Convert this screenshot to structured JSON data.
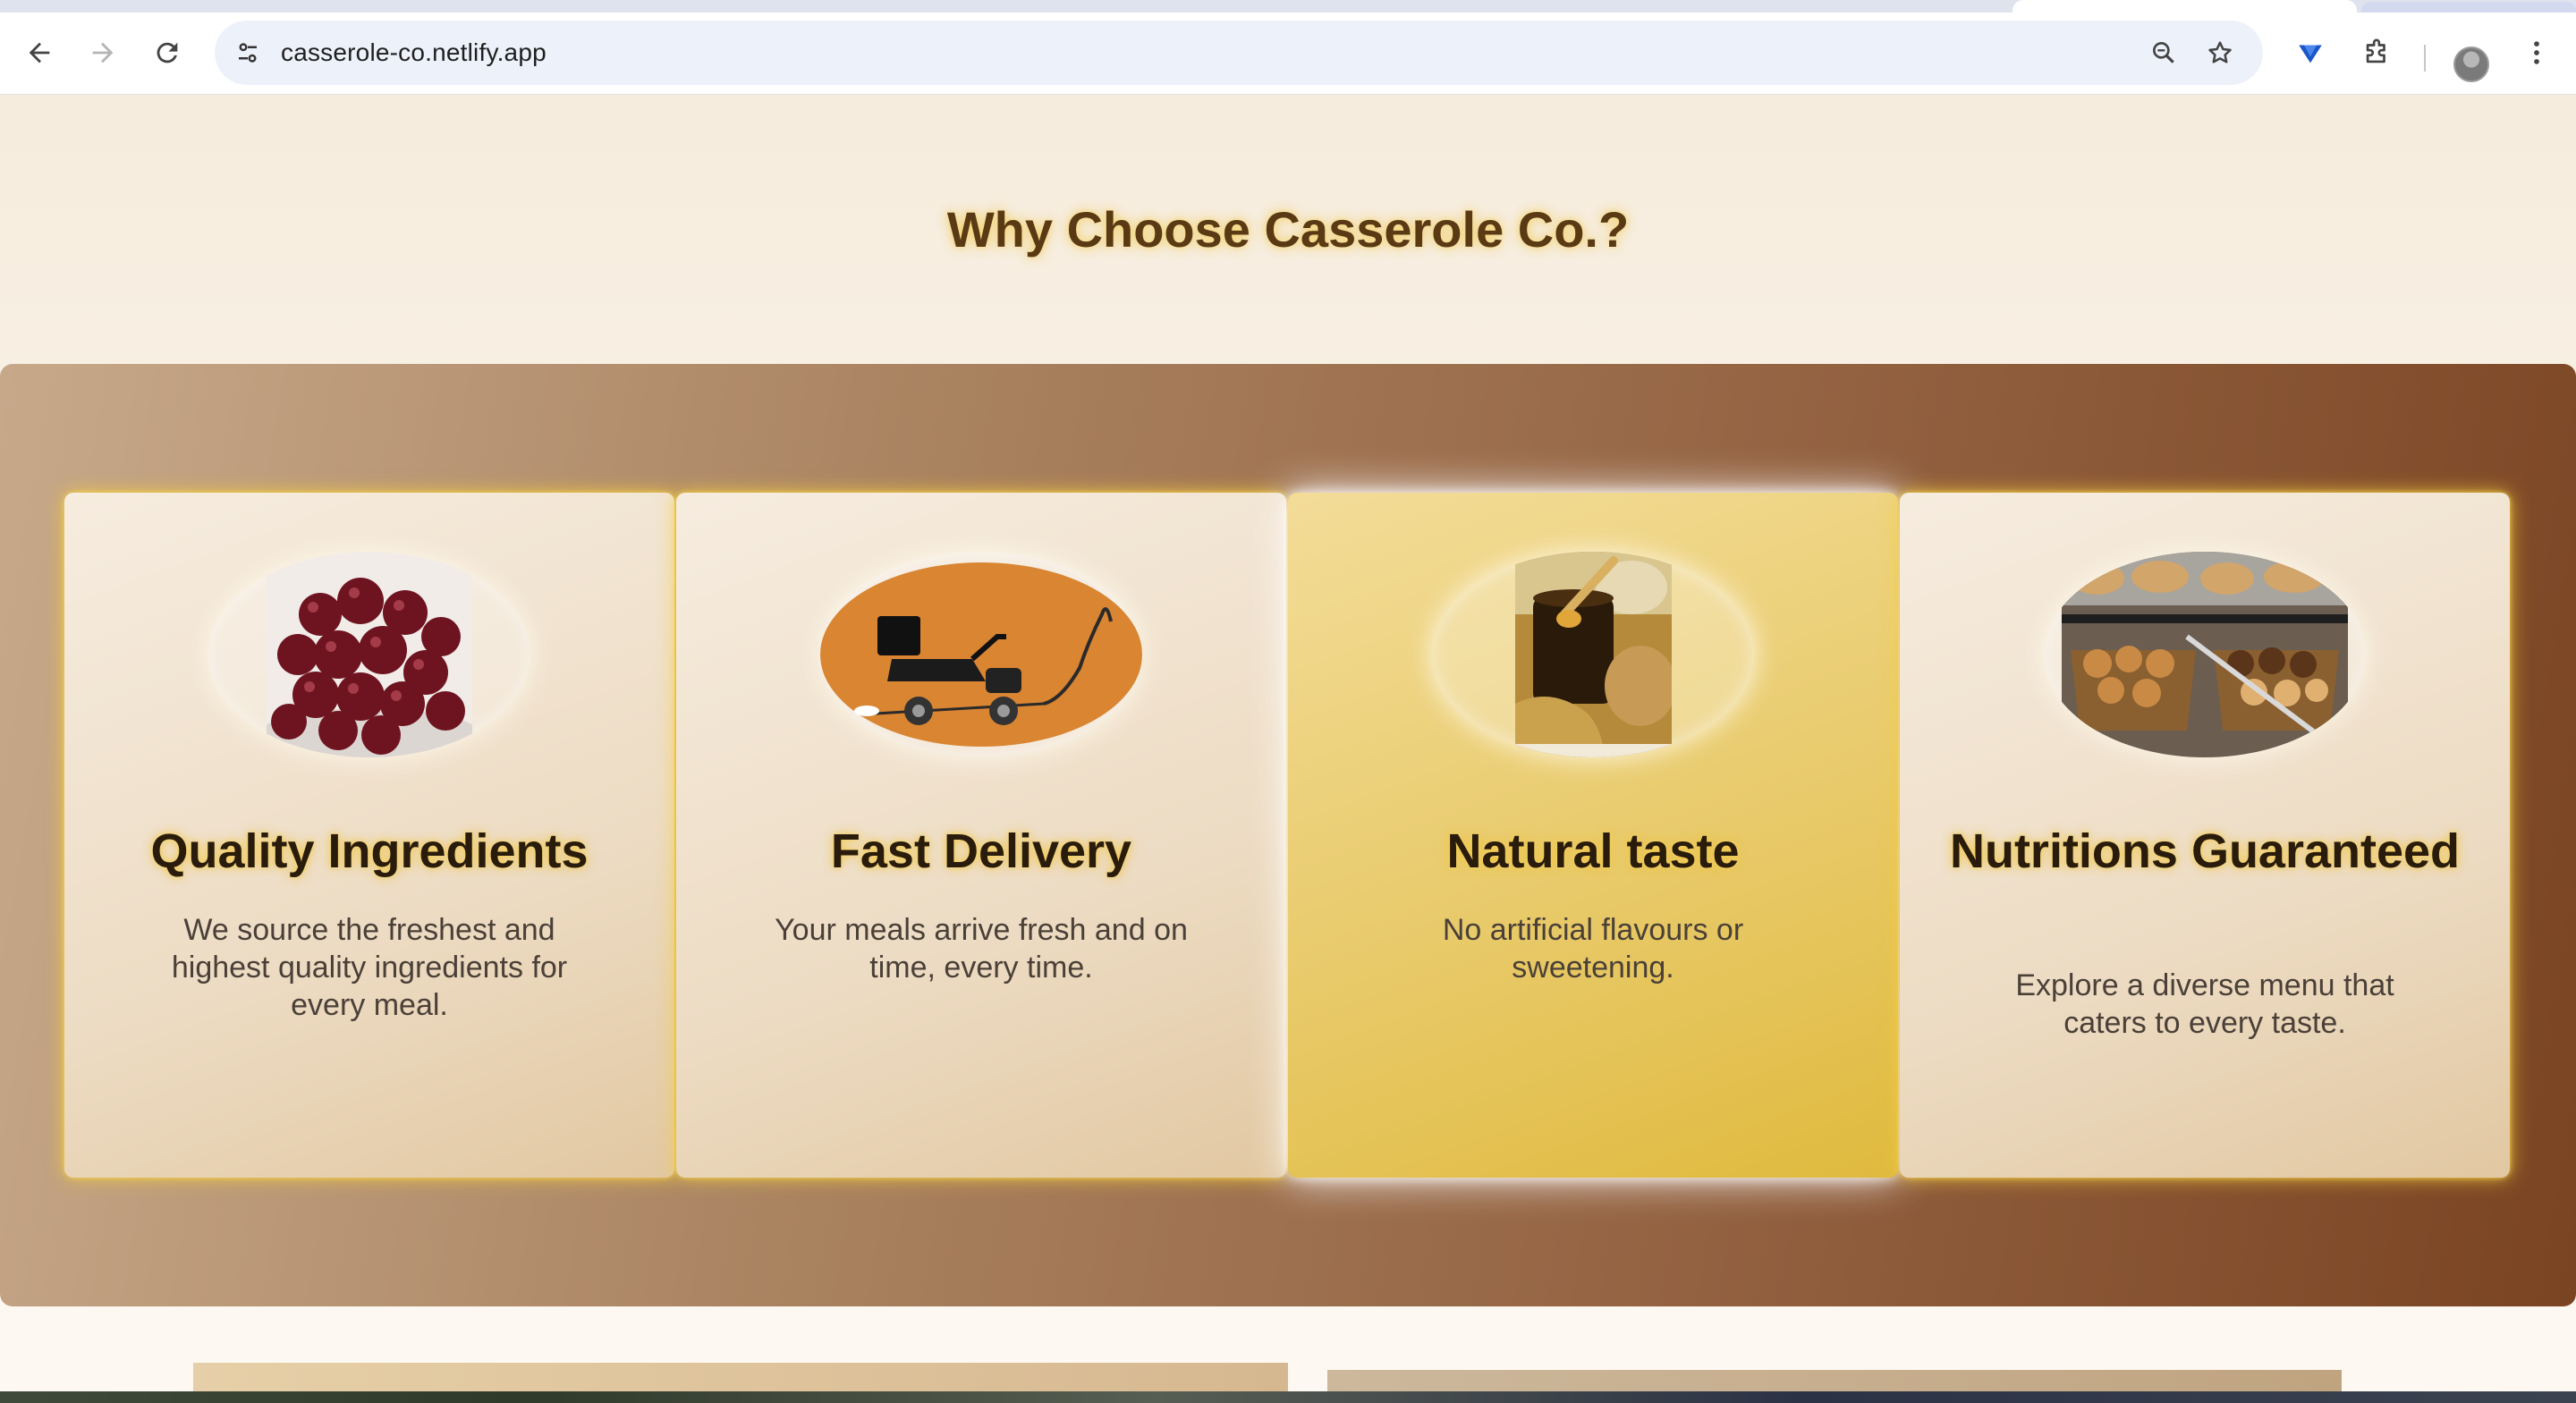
{
  "browser": {
    "url": "casserole-co.netlify.app",
    "icons": {
      "back": "arrow-left-icon",
      "forward": "arrow-right-icon",
      "reload": "reload-icon",
      "site_info": "tune-icon",
      "zoom": "zoom-icon",
      "bookmark": "star-icon",
      "extension_pinned": "diamond-icon",
      "extensions": "puzzle-icon",
      "menu": "kebab-menu-icon"
    }
  },
  "section": {
    "title": "Why Choose Casserole Co.?"
  },
  "cards": [
    {
      "title": "Quality Ingredients",
      "description": "We source the freshest and highest quality ingredients for every meal.",
      "image": "cherries"
    },
    {
      "title": "Fast Delivery",
      "description": "Your meals arrive fresh and on time, every time.",
      "image": "delivery-scooter"
    },
    {
      "title": "Natural taste",
      "description": "No artificial flavours or sweetening.",
      "image": "honey-jar"
    },
    {
      "title": "Nutritions Guaranteed",
      "description": "Explore a diverse menu that caters to every taste.",
      "image": "pastries"
    }
  ],
  "colors": {
    "title_text": "#5a3a14",
    "title_glow": "#f0c850",
    "band_start": "#c7a98a",
    "band_end": "#7a4422",
    "highlight_card": "#e8ca6a"
  }
}
